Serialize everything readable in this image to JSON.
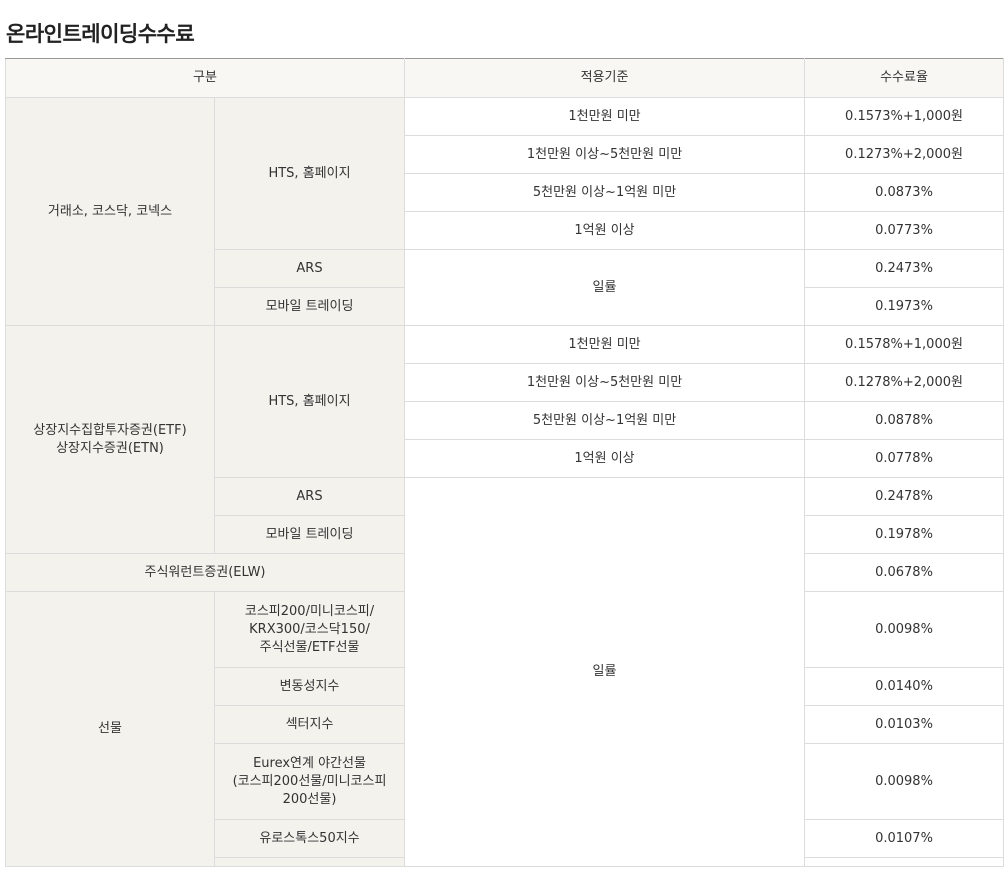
{
  "page_title": "온라인트레이딩수수료",
  "headers": {
    "category": "구분",
    "standard": "적용기준",
    "rate": "수수료율"
  },
  "groups": {
    "exchange": {
      "label": "거래소, 코스닥, 코넥스",
      "hts": "HTS, 홈페이지",
      "tiers": [
        {
          "standard": "1천만원 미만",
          "rate": "0.1573%+1,000원"
        },
        {
          "standard": "1천만원 이상~5천만원 미만",
          "rate": "0.1273%+2,000원"
        },
        {
          "standard": "5천만원 이상~1억원 미만",
          "rate": "0.0873%"
        },
        {
          "standard": "1억원 이상",
          "rate": "0.0773%"
        }
      ],
      "ars": "ARS",
      "ars_rate": "0.2473%",
      "mobile": "모바일 트레이딩",
      "mobile_rate": "0.1973%",
      "flat": "일률"
    },
    "etf": {
      "label_line1": "상장지수집합투자증권(ETF)",
      "label_line2": "상장지수증권(ETN)",
      "hts": "HTS, 홈페이지",
      "tiers": [
        {
          "standard": "1천만원 미만",
          "rate": "0.1578%+1,000원"
        },
        {
          "standard": "1천만원 이상~5천만원 미만",
          "rate": "0.1278%+2,000원"
        },
        {
          "standard": "5천만원 이상~1억원 미만",
          "rate": "0.0878%"
        },
        {
          "standard": "1억원 이상",
          "rate": "0.0778%"
        }
      ],
      "ars": "ARS",
      "ars_rate": "0.2478%",
      "mobile": "모바일 트레이딩",
      "mobile_rate": "0.1978%"
    },
    "elw": {
      "label": "주식워런트증권(ELW)",
      "rate": "0.0678%"
    },
    "futures": {
      "label": "선물",
      "items": [
        {
          "line1": "코스피200/미니코스피/",
          "line2": "KRX300/코스닥150/",
          "line3": "주식선물/ETF선물",
          "rate": "0.0098%"
        },
        {
          "line1": "변동성지수",
          "rate": "0.0140%"
        },
        {
          "line1": "섹터지수",
          "rate": "0.0103%"
        },
        {
          "line1": "Eurex연계 야간선물",
          "line2": "(코스피200선물/미니코스피",
          "line3": "200선물)",
          "rate": "0.0098%"
        },
        {
          "line1": "유로스톡스50지수",
          "rate": "0.0107%"
        }
      ]
    },
    "flat_shared": "일률"
  }
}
